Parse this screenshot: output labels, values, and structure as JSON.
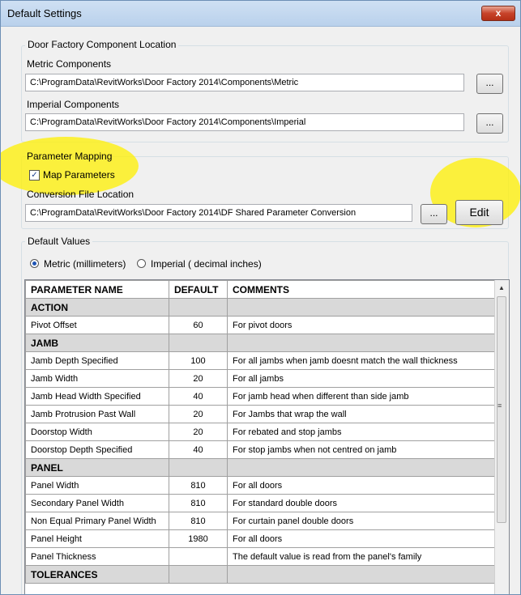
{
  "window": {
    "title": "Default Settings",
    "close_glyph": "x"
  },
  "location": {
    "legend": "Door Factory Component Location",
    "metric_label": "Metric Components",
    "metric_path": "C:\\ProgramData\\RevitWorks\\Door Factory 2014\\Components\\Metric",
    "imperial_label": "Imperial Components",
    "imperial_path": "C:\\ProgramData\\RevitWorks\\Door Factory 2014\\Components\\Imperial",
    "browse_label": "..."
  },
  "mapping": {
    "legend": "Parameter Mapping",
    "checkbox_label": "Map Parameters",
    "checked": true,
    "conversion_label": "Conversion File Location",
    "conversion_path": "C:\\ProgramData\\RevitWorks\\Door Factory 2014\\DF Shared Parameter Conversion",
    "browse_label": "...",
    "edit_label": "Edit"
  },
  "defaults": {
    "legend": "Default Values",
    "radio_metric": "Metric (millimeters)",
    "radio_imperial": "Imperial ( decimal inches)",
    "selected": "metric"
  },
  "table": {
    "headers": [
      "PARAMETER NAME",
      "DEFAULT",
      "COMMENTS"
    ],
    "rows": [
      {
        "section": "ACTION"
      },
      {
        "name": "Pivot Offset",
        "default": "60",
        "comment": "For pivot doors"
      },
      {
        "section": "JAMB"
      },
      {
        "name": "Jamb Depth Specified",
        "default": "100",
        "comment": "For all jambs when jamb doesnt match the wall thickness"
      },
      {
        "name": "Jamb Width",
        "default": "20",
        "comment": "For all jambs"
      },
      {
        "name": "Jamb Head Width Specified",
        "default": "40",
        "comment": "For jamb head when different than side jamb"
      },
      {
        "name": "Jamb Protrusion Past Wall",
        "default": "20",
        "comment": "For Jambs that wrap the wall"
      },
      {
        "name": "Doorstop Width",
        "default": "20",
        "comment": "For rebated and stop jambs"
      },
      {
        "name": "Doorstop Depth Specified",
        "default": "40",
        "comment": "For stop jambs when not centred on jamb"
      },
      {
        "section": "PANEL"
      },
      {
        "name": "Panel Width",
        "default": "810",
        "comment": "For all doors"
      },
      {
        "name": "Secondary Panel Width",
        "default": "810",
        "comment": "For standard double doors"
      },
      {
        "name": "Non Equal Primary Panel Width",
        "default": "810",
        "comment": "For curtain panel double doors"
      },
      {
        "name": "Panel Height",
        "default": "1980",
        "comment": "For all doors"
      },
      {
        "name": "Panel Thickness",
        "default": "",
        "comment": "The default value is read from the panel's family"
      },
      {
        "section": "TOLERANCES"
      }
    ]
  },
  "highlight_color": "#fff000"
}
